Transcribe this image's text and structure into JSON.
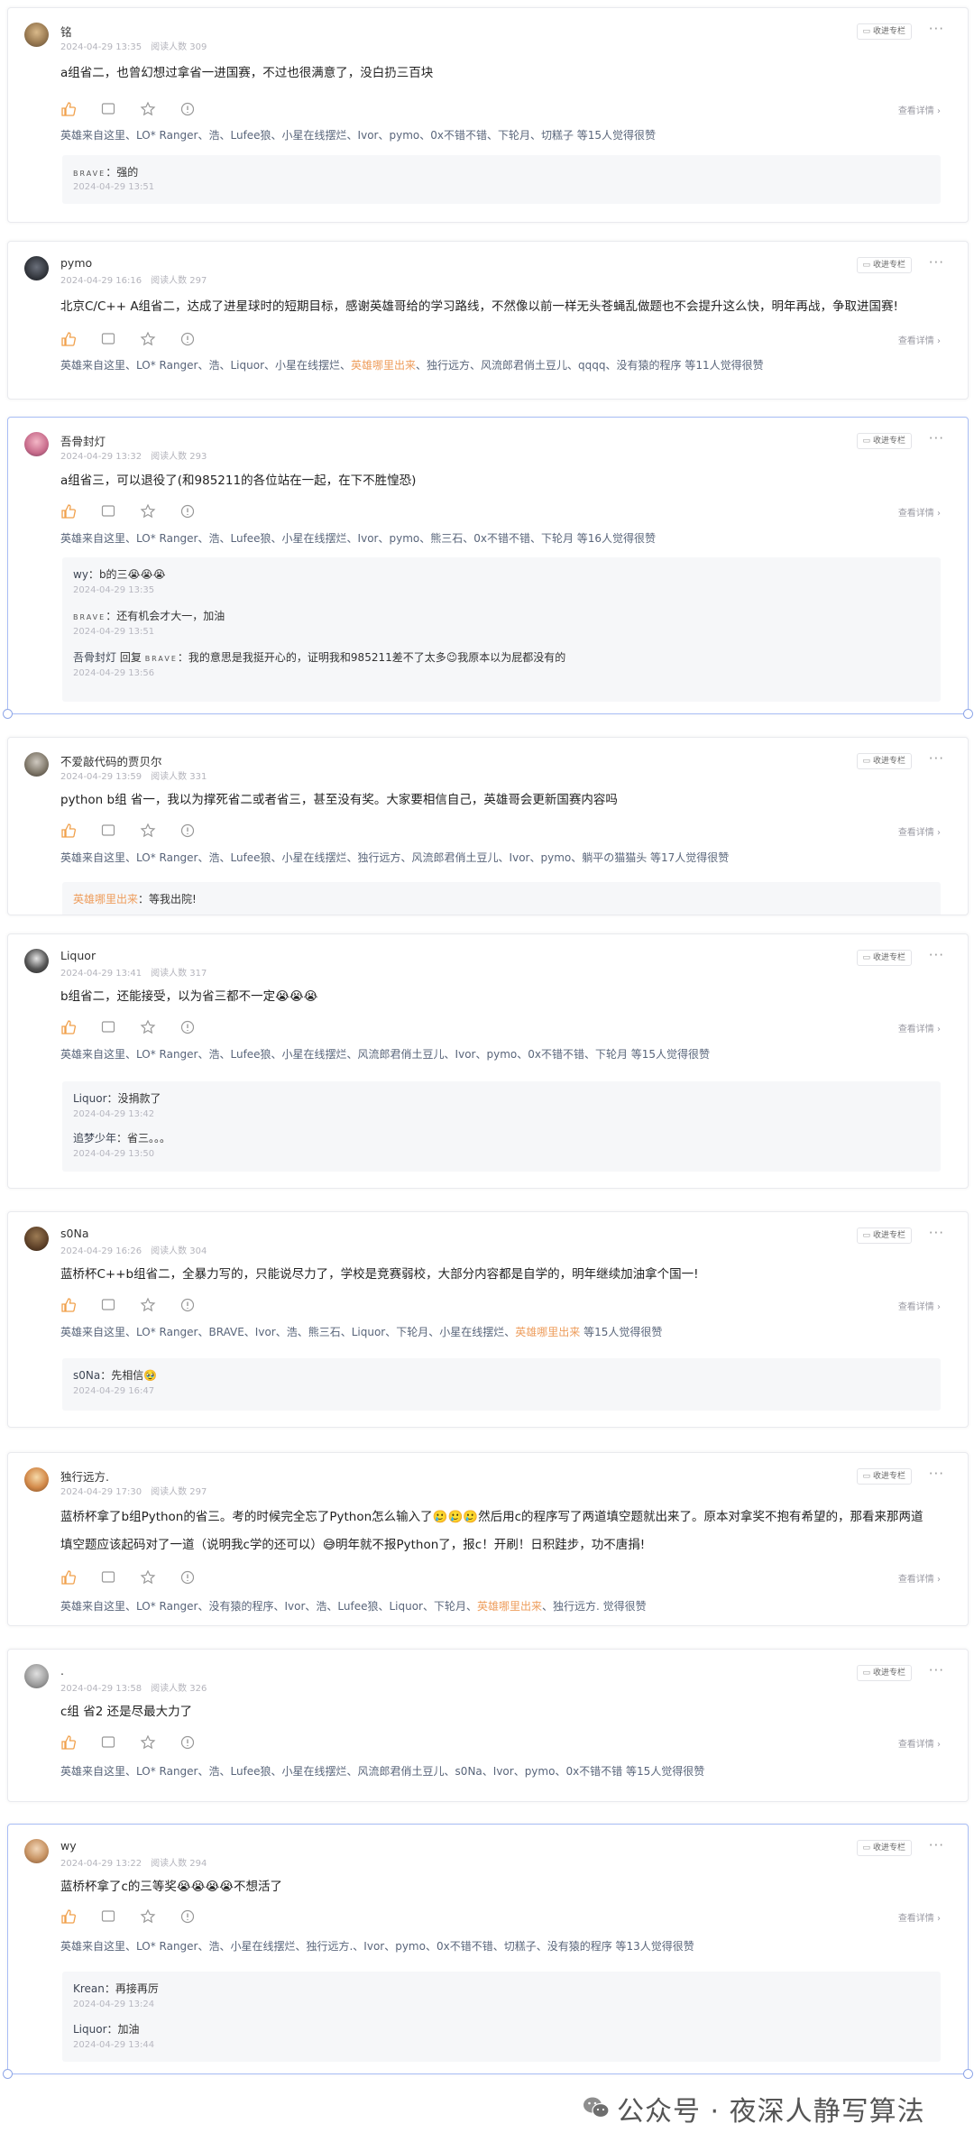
{
  "ui": {
    "pin_label": "收进专栏",
    "more_label": "···",
    "view_details": "查看详情 ›",
    "read_prefix": "阅读人数"
  },
  "watermark": "公众号 · 夜深人静写算法",
  "posts": [
    {
      "user": "铭",
      "time": "2024-04-29 13:35",
      "reads": "阅读人数 309",
      "content": "a组省二，也曾幻想过拿省一进国赛，不过也很满意了，没白扔三百块",
      "likes": "英雄来自这里、LO* Ranger、浩、Lufee狼、小星在线摆烂、Ivor、pymo、0x不错不错、下轮月、切糕子 等15人觉得很赞",
      "replies": [
        {
          "name": "BRAVE",
          "text": "强的",
          "time": "2024-04-29 13:51"
        }
      ]
    },
    {
      "user": "pymo",
      "time": "2024-04-29 16:16",
      "reads": "阅读人数 297",
      "content": "北京C/C++ A组省二，达成了进星球时的短期目标，感谢英雄哥给的学习路线，不然像以前一样无头苍蝇乱做题也不会提升这么快，明年再战，争取进国赛!",
      "likes_a": "英雄来自这里、LO* Ranger、浩、Liquor、小星在线摆烂、",
      "likes_hl": "英雄哪里出来",
      "likes_b": "、独行远方、风流郎君俏土豆儿、qqqq、没有猿的程序 等11人觉得很赞"
    },
    {
      "user": "吾骨封灯",
      "time": "2024-04-29 13:32",
      "reads": "阅读人数 293",
      "content": "a组省三，可以退役了(和985211的各位站在一起，在下不胜惶恐)",
      "likes": "英雄来自这里、LO* Ranger、浩、Lufee狼、小星在线摆烂、Ivor、pymo、熊三石、0x不错不错、下轮月 等16人觉得很赞",
      "replies": [
        {
          "name": "wy",
          "text": "b的三😭😭😭",
          "time": "2024-04-29 13:35"
        },
        {
          "name": "BRAVE",
          "text": "还有机会才大一，加油",
          "time": "2024-04-29 13:51"
        },
        {
          "name": "吾骨封灯",
          "reply_word": "回复",
          "target": "BRAVE",
          "text": "我的意思是我挺开心的，证明我和985211差不了太多😉我原本以为屁都没有的",
          "time": "2024-04-29 13:56"
        }
      ]
    },
    {
      "user": "不爱敲代码的贾贝尔",
      "time": "2024-04-29 13:59",
      "reads": "阅读人数 331",
      "content": "python b组 省一，我以为撑死省二或者省三，甚至没有奖。大家要相信自己，英雄哥会更新国赛内容吗",
      "likes": "英雄来自这里、LO* Ranger、浩、Lufee狼、小星在线摆烂、独行远方、风流郎君俏土豆儿、Ivor、pymo、躺平の猫猫头 等17人觉得很赞",
      "replies": [
        {
          "name": "英雄哪里出来",
          "text": "等我出院!",
          "time": ""
        }
      ]
    },
    {
      "user": "Liquor",
      "time": "2024-04-29 13:41",
      "reads": "阅读人数 317",
      "content": "b组省二，还能接受，以为省三都不一定😭😭😭",
      "likes": "英雄来自这里、LO* Ranger、浩、Lufee狼、小星在线摆烂、风流郎君俏土豆儿、Ivor、pymo、0x不错不错、下轮月 等15人觉得很赞",
      "replies": [
        {
          "name": "Liquor",
          "text": "没捐款了",
          "time": "2024-04-29 13:42"
        },
        {
          "name": "追梦少年",
          "text": "省三。。。",
          "time": "2024-04-29 13:50"
        }
      ]
    },
    {
      "user": "s0Na",
      "time": "2024-04-29 16:26",
      "reads": "阅读人数 304",
      "content": "蓝桥杯C++b组省二，全暴力写的，只能说尽力了，学校是竞赛弱校，大部分内容都是自学的，明年继续加油拿个国一!",
      "likes_a": "英雄来自这里、LO* Ranger、BRAVE、Ivor、浩、熊三石、Liquor、下轮月、小星在线摆烂、",
      "likes_hl": "英雄哪里出来",
      "likes_b": " 等15人觉得很赞",
      "replies": [
        {
          "name": "s0Na",
          "text": "先相信🥹",
          "time": "2024-04-29 16:47"
        }
      ]
    },
    {
      "user": "独行远方.",
      "time": "2024-04-29 17:30",
      "reads": "阅读人数 297",
      "content": "蓝桥杯拿了b组Python的省三。考的时候完全忘了Python怎么输入了🥲🥲🥲然后用c的程序写了两道填空题就出来了。原本对拿奖不抱有希望的，那看来那两道填空题应该起码对了一道（说明我c学的还可以）😅明年就不报Python了，报c！开刷！日积跬步，功不唐捐!",
      "likes_a": "英雄来自这里、LO* Ranger、没有猿的程序、Ivor、浩、Lufee狼、Liquor、下轮月、",
      "likes_hl": "英雄哪里出来",
      "likes_b": "、独行远方. 觉得很赞"
    },
    {
      "user": ".",
      "time": "2024-04-29 13:58",
      "reads": "阅读人数 326",
      "content": "c组 省2 还是尽最大力了",
      "likes": "英雄来自这里、LO* Ranger、浩、Lufee狼、小星在线摆烂、风流郎君俏土豆儿、s0Na、Ivor、pymo、0x不错不错 等15人觉得很赞"
    },
    {
      "user": "wy",
      "time": "2024-04-29 13:22",
      "reads": "阅读人数 294",
      "content": "蓝桥杯拿了c的三等奖😭😭😭😭不想活了",
      "likes": "英雄来自这里、LO* Ranger、浩、小星在线摆烂、独行远方.、Ivor、pymo、0x不错不错、切糕子、没有猿的程序 等13人觉得很赞",
      "replies": [
        {
          "name": "Krean",
          "text": "再接再厉",
          "time": "2024-04-29 13:24"
        },
        {
          "name": "Liquor",
          "text": "加油",
          "time": "2024-04-29 13:44"
        }
      ]
    }
  ]
}
